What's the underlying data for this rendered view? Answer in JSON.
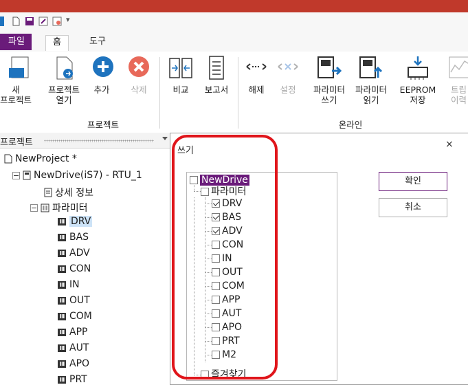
{
  "ribbon_tabs": [
    "파일",
    "홈",
    "도구"
  ],
  "ribbon": {
    "project_buttons": [
      {
        "label1": "새",
        "label2": "프로젝트",
        "icon": "new-project-icon"
      },
      {
        "label1": "프로젝트",
        "label2": "열기",
        "icon": "open-project-icon"
      },
      {
        "label1": "추가",
        "label2": "",
        "icon": "add-icon"
      },
      {
        "label1": "삭제",
        "label2": "",
        "icon": "delete-icon",
        "disabled": true
      }
    ],
    "compare_buttons": [
      {
        "label": "비교",
        "icon": "compare-icon"
      },
      {
        "label": "보고서",
        "icon": "report-icon"
      }
    ],
    "online_buttons": [
      {
        "label1": "해제",
        "label2": "",
        "icon": "disconnect-icon"
      },
      {
        "label1": "설정",
        "label2": "",
        "icon": "connect-settings-icon",
        "disabled": true
      },
      {
        "label1": "파라미터",
        "label2": "쓰기",
        "icon": "parameter-write-icon"
      },
      {
        "label1": "파라미터",
        "label2": "읽기",
        "icon": "parameter-read-icon"
      },
      {
        "label1": "EEPROM",
        "label2": "저장",
        "icon": "eeprom-save-icon"
      },
      {
        "label1": "트립",
        "label2": "이력",
        "icon": "trip-history-icon",
        "disabled": true
      }
    ],
    "group_project": "프로젝트",
    "group_online": "온라인"
  },
  "project_panel": {
    "title": "프로젝트",
    "root": "NewProject *",
    "drive": "NewDrive(iS7) - RTU_1",
    "detail": "상세 정보",
    "params_label": "파라미터",
    "params": [
      "DRV",
      "BAS",
      "ADV",
      "CON",
      "IN",
      "OUT",
      "COM",
      "APP",
      "AUT",
      "APO",
      "PRT"
    ],
    "selected": "DRV"
  },
  "dialog": {
    "title": "쓰기",
    "close": "×",
    "tree": {
      "drive": "NewDrive",
      "params_label": "파라미터",
      "items": [
        {
          "label": "DRV",
          "checked": true
        },
        {
          "label": "BAS",
          "checked": true
        },
        {
          "label": "ADV",
          "checked": true
        },
        {
          "label": "CON",
          "checked": false
        },
        {
          "label": "IN",
          "checked": false
        },
        {
          "label": "OUT",
          "checked": false
        },
        {
          "label": "COM",
          "checked": false
        },
        {
          "label": "APP",
          "checked": false
        },
        {
          "label": "AUT",
          "checked": false
        },
        {
          "label": "APO",
          "checked": false
        },
        {
          "label": "PRT",
          "checked": false
        },
        {
          "label": "M2",
          "checked": false
        }
      ],
      "favorites": "즐겨찾기"
    },
    "ok": "확인",
    "cancel": "취소"
  },
  "colors": {
    "accent": "#6a1b7a",
    "titlebar": "#c0392b",
    "annotation": "#e0151b",
    "add": "#1e73be",
    "delete": "#e8695a"
  }
}
